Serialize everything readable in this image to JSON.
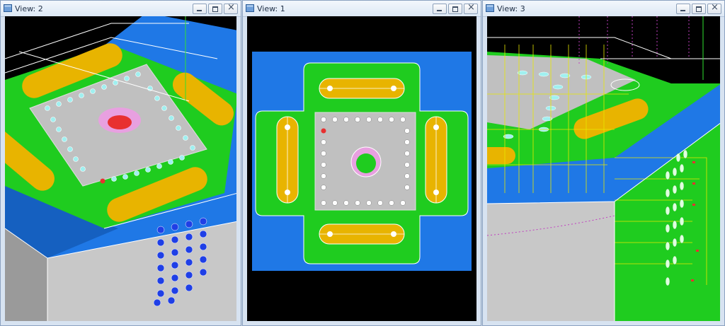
{
  "windows": [
    {
      "title": "View: 2",
      "buttons": [
        "minimize",
        "restore",
        "close"
      ]
    },
    {
      "title": "View: 1",
      "buttons": [
        "minimize",
        "restore",
        "close"
      ]
    },
    {
      "title": "View: 3",
      "buttons": [
        "minimize",
        "restore",
        "close"
      ]
    }
  ],
  "colors": {
    "background": "#000000",
    "mold_blue": "#1f78e6",
    "mold_green": "#1fcc1f",
    "slot_yellow": "#e8b400",
    "plate_gray": "#c0c0c0",
    "accent_pink": "#e8a0e0",
    "wire_yellow": "#e8e800",
    "wire_red": "#e83030"
  }
}
